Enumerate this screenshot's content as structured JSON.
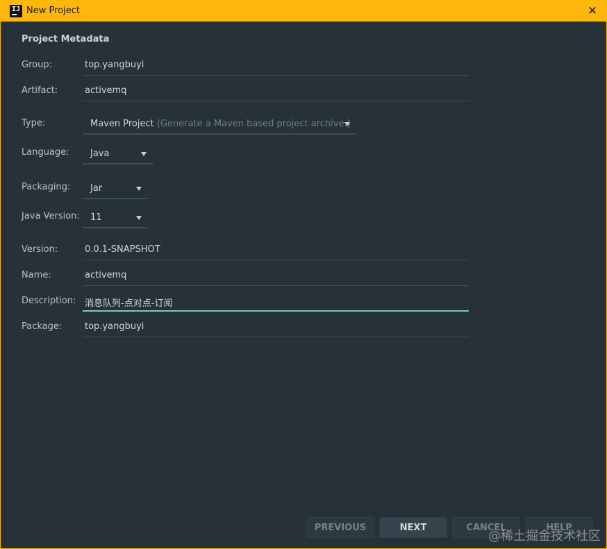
{
  "window": {
    "title": "New Project",
    "close_glyph": "✕",
    "app_icon_label": "IJ"
  },
  "section_title": "Project Metadata",
  "fields": {
    "group": {
      "label": "Group:",
      "value": "top.yangbuyi"
    },
    "artifact": {
      "label": "Artifact:",
      "value": "activemq"
    },
    "type": {
      "label": "Type:",
      "value": "Maven Project",
      "hint": "(Generate a Maven based project archive.)"
    },
    "language": {
      "label": "Language:",
      "value": "Java"
    },
    "packaging": {
      "label": "Packaging:",
      "value": "Jar"
    },
    "java_version": {
      "label": "Java Version:",
      "value": "11"
    },
    "version": {
      "label": "Version:",
      "value": "0.0.1-SNAPSHOT"
    },
    "name": {
      "label": "Name:",
      "value": "activemq"
    },
    "description": {
      "label": "Description:",
      "value": "消息队列-点对点-订阅"
    },
    "package": {
      "label": "Package:",
      "value": "top.yangbuyi"
    }
  },
  "buttons": {
    "previous": "PREVIOUS",
    "next": "NEXT",
    "cancel": "CANCEL",
    "help": "HELP"
  },
  "watermark": "@稀土掘金技术社区",
  "colors": {
    "titlebar": "#ffb70f",
    "background": "#263238",
    "focus": "#7ac9c3"
  },
  "icons": {
    "app": "intellij-icon",
    "close": "close-icon",
    "dropdown": "chevron-down-icon"
  }
}
